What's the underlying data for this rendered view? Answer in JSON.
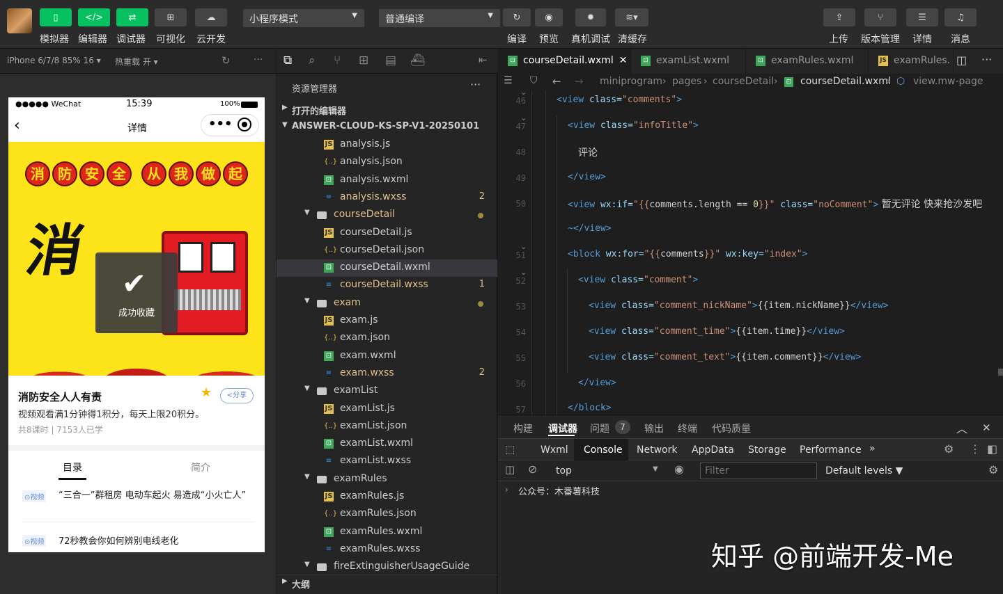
{
  "toolbar": {
    "buttons": [
      {
        "label": "模拟器",
        "glyph": "▯"
      },
      {
        "label": "编辑器",
        "glyph": "</>"
      },
      {
        "label": "调试器",
        "glyph": "⇄"
      },
      {
        "label": "可视化",
        "glyph": "⊞"
      },
      {
        "label": "云开发",
        "glyph": "☁"
      }
    ],
    "mode_select": "小程序模式",
    "compile_select": "普通编译",
    "actions": [
      "编译",
      "预览",
      "真机调试",
      "清缓存"
    ],
    "right": [
      "上传",
      "版本管理",
      "详情",
      "消息"
    ]
  },
  "simulator_bar": {
    "device": "iPhone 6/7/8 85% 16 ▾",
    "hotreload": "热重载 开 ▾"
  },
  "phone": {
    "status_dots": "●●●●● WeChat",
    "status_time": "15:39",
    "battery": "100%",
    "nav_title": "详情",
    "banner_chars": [
      "消",
      "防",
      "安",
      "全",
      "从",
      "我",
      "做",
      "起"
    ],
    "big_char": "消",
    "toast": "成功收藏",
    "course_title": "消防安全人人有责",
    "share": "<分享",
    "desc": "视频观看满1分钟得1积分，每天上限20积分。",
    "meta": "共8课时 | 7153人已学",
    "tabs": [
      "目录",
      "简介"
    ],
    "items": [
      {
        "tag": "⊙视频",
        "text": "“三合一”群租房 电动车起火 易造成“小火亡人”"
      },
      {
        "tag": "⊙视频",
        "text": "72秒教会你如何辨别电线老化"
      }
    ]
  },
  "explorer": {
    "title": "资源管理器",
    "open_editors": "打开的编辑器",
    "project": "ANSWER-CLOUD-KS-SP-V1-20250101",
    "outline": "大纲",
    "rows": [
      {
        "name": "analysis.js",
        "type": "js"
      },
      {
        "name": "analysis.json",
        "type": "json"
      },
      {
        "name": "analysis.wxml",
        "type": "wxml"
      },
      {
        "name": "analysis.wxss",
        "type": "wxss",
        "badge": "2"
      },
      {
        "name": "courseDetail",
        "type": "folder",
        "dot": true
      },
      {
        "name": "courseDetail.js",
        "type": "js"
      },
      {
        "name": "courseDetail.json",
        "type": "json"
      },
      {
        "name": "courseDetail.wxml",
        "type": "wxml",
        "selected": true
      },
      {
        "name": "courseDetail.wxss",
        "type": "wxss",
        "badge": "1"
      },
      {
        "name": "exam",
        "type": "folder",
        "dot": true
      },
      {
        "name": "exam.js",
        "type": "js"
      },
      {
        "name": "exam.json",
        "type": "json"
      },
      {
        "name": "exam.wxml",
        "type": "wxml"
      },
      {
        "name": "exam.wxss",
        "type": "wxss",
        "badge": "2"
      },
      {
        "name": "examList",
        "type": "folder"
      },
      {
        "name": "examList.js",
        "type": "js"
      },
      {
        "name": "examList.json",
        "type": "json"
      },
      {
        "name": "examList.wxml",
        "type": "wxml"
      },
      {
        "name": "examList.wxss",
        "type": "wxss"
      },
      {
        "name": "examRules",
        "type": "folder"
      },
      {
        "name": "examRules.js",
        "type": "js"
      },
      {
        "name": "examRules.json",
        "type": "json"
      },
      {
        "name": "examRules.wxml",
        "type": "wxml"
      },
      {
        "name": "examRules.wxss",
        "type": "wxss"
      },
      {
        "name": "fireExtinguisherUsageGuide",
        "type": "folder"
      }
    ]
  },
  "editor_tabs": [
    {
      "name": "courseDetail.wxml",
      "type": "wxml",
      "active": true,
      "close": "✕"
    },
    {
      "name": "examList.wxml",
      "type": "wxml"
    },
    {
      "name": "examRules.wxml",
      "type": "wxml"
    },
    {
      "name": "examRules.",
      "type": "js"
    }
  ],
  "breadcrumb": [
    "miniprogram",
    "pages",
    "courseDetail",
    "courseDetail.wxml",
    "view.mw-page"
  ],
  "lines": [
    "46",
    "47",
    "48",
    "49",
    "50",
    "51",
    "52",
    "53",
    "54",
    "55",
    "56",
    "57"
  ],
  "code": {
    "l46": [
      "<view ",
      "class=",
      "\"comments\"",
      ">"
    ],
    "l47": [
      "<view ",
      "class=",
      "\"infoTitle\"",
      ">"
    ],
    "l48": "评论",
    "l49": "</view>",
    "l50": [
      "<view ",
      "wx:if=",
      "\"{{",
      "comments.length",
      " == ",
      "0",
      "}}\"",
      " class=",
      "\"noComment\"",
      ">",
      " 暂无评论 快来抢沙发吧"
    ],
    "l50b": "~</view>",
    "l51": [
      "<block ",
      "wx:for=",
      "\"{{",
      "comments",
      "}}\"",
      " wx:key=",
      "\"index\"",
      ">"
    ],
    "l52": [
      "<view ",
      "class=",
      "\"comment\"",
      ">"
    ],
    "l53": [
      "<view ",
      "class=",
      "\"comment_nickName\"",
      ">",
      "{{item.nickName}}",
      "</view>"
    ],
    "l54": [
      "<view ",
      "class=",
      "\"comment_time\"",
      ">",
      "{{item.time}}",
      "</view>"
    ],
    "l55": [
      "<view ",
      "class=",
      "\"comment_text\"",
      ">",
      "{{item.comment}}",
      "</view>"
    ],
    "l56": "</view>",
    "l57": "</block>"
  },
  "devtools": {
    "tabs": [
      "构建",
      "调试器",
      "问题",
      "输出",
      "终端",
      "代码质量"
    ],
    "issues": "7",
    "panels": [
      "Wxml",
      "Console",
      "Network",
      "AppData",
      "Storage",
      "Performance",
      "»"
    ],
    "context": "top",
    "filter_placeholder": "Filter",
    "levels": "Default levels ▼",
    "log": "公众号：木番薯科技",
    "watermark": "知乎 @前端开发-Me"
  }
}
